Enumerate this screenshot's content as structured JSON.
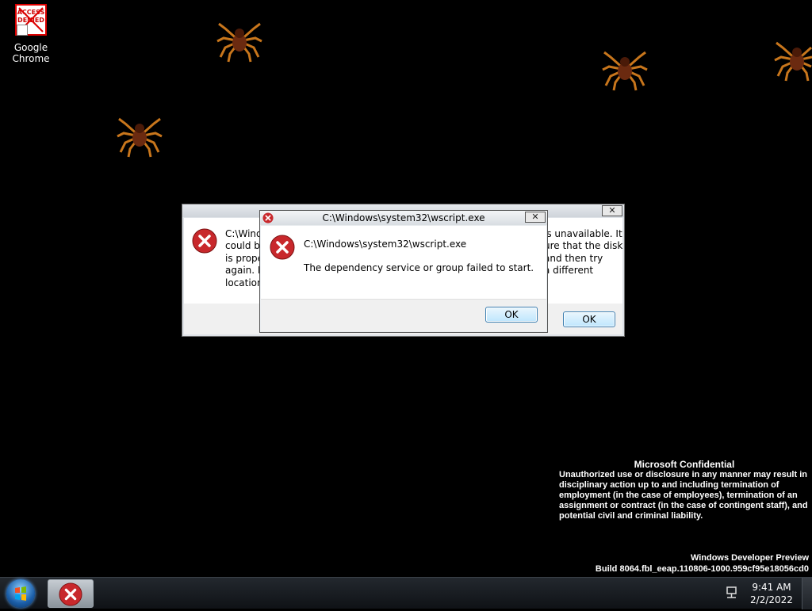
{
  "desktop": {
    "icon_label": "Google Chrome",
    "icon_overlay_text": "ACCESS DENIED"
  },
  "back_dialog": {
    "button_ok": "OK",
    "message_left": "C:\\Windo\ncould be\nis prope\nagain. If\nlocation",
    "message_right": "is unavailable. It\nure that the disk\nand then try\na different",
    "close_glyph": "✕"
  },
  "front_dialog": {
    "title": "C:\\Windows\\system32\\wscript.exe",
    "heading": "C:\\Windows\\system32\\wscript.exe",
    "message": "The dependency service or group failed to start.",
    "button_ok": "OK",
    "close_glyph": "✕"
  },
  "watermark": {
    "title": "Microsoft Confidential",
    "body": "Unauthorized use or disclosure in any manner may result in disciplinary action up to and including termination of employment (in the case of employees), termination of an assignment or contract (in the case of contingent staff), and potential civil and criminal liability."
  },
  "build": {
    "line1": "Windows Developer Preview",
    "line2": "Build 8064.fbl_eeap.110806-1000.959cf95e18056cd0"
  },
  "taskbar": {
    "time": "9:41 AM",
    "date": "2/2/2022"
  },
  "icons": [
    "start-orb-icon",
    "error-icon",
    "network-icon",
    "spider-icon",
    "close-icon"
  ],
  "colors": {
    "desktop_bg": "#000000",
    "error_red": "#c8282c",
    "button_blue": "#3c7fb1"
  }
}
